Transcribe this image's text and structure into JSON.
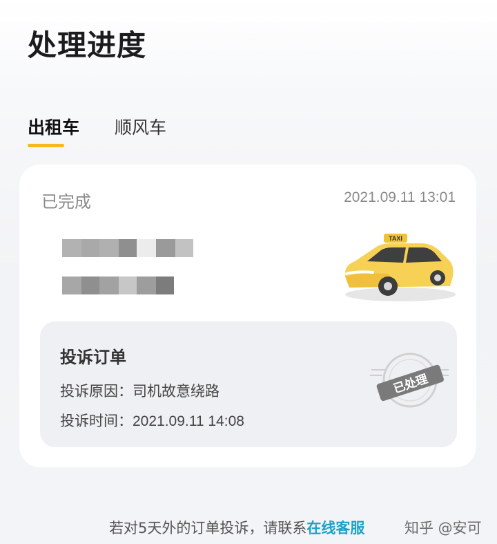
{
  "page": {
    "title": "处理进度"
  },
  "tabs": [
    {
      "label": "出租车",
      "active": true
    },
    {
      "label": "顺风车",
      "active": false
    }
  ],
  "order": {
    "status": "已完成",
    "timestamp": "2021.09.11 13:01",
    "vehicle_icon": "taxi-icon",
    "taxi_sign_text": "TAXI"
  },
  "complaint": {
    "title": "投诉订单",
    "reason_label": "投诉原因：",
    "reason_value": "司机故意绕路",
    "time_label": "投诉时间：",
    "time_value": "2021.09.11 14:08",
    "stamp_text": "已处理"
  },
  "footer": {
    "prefix": "若对5天外的订单投诉，请联系",
    "link": "在线客服",
    "watermark": "知乎 @安可"
  },
  "colors": {
    "accent_yellow": "#f5b91b",
    "link_blue": "#1aa3c8",
    "taxi_body": "#f6d155"
  }
}
